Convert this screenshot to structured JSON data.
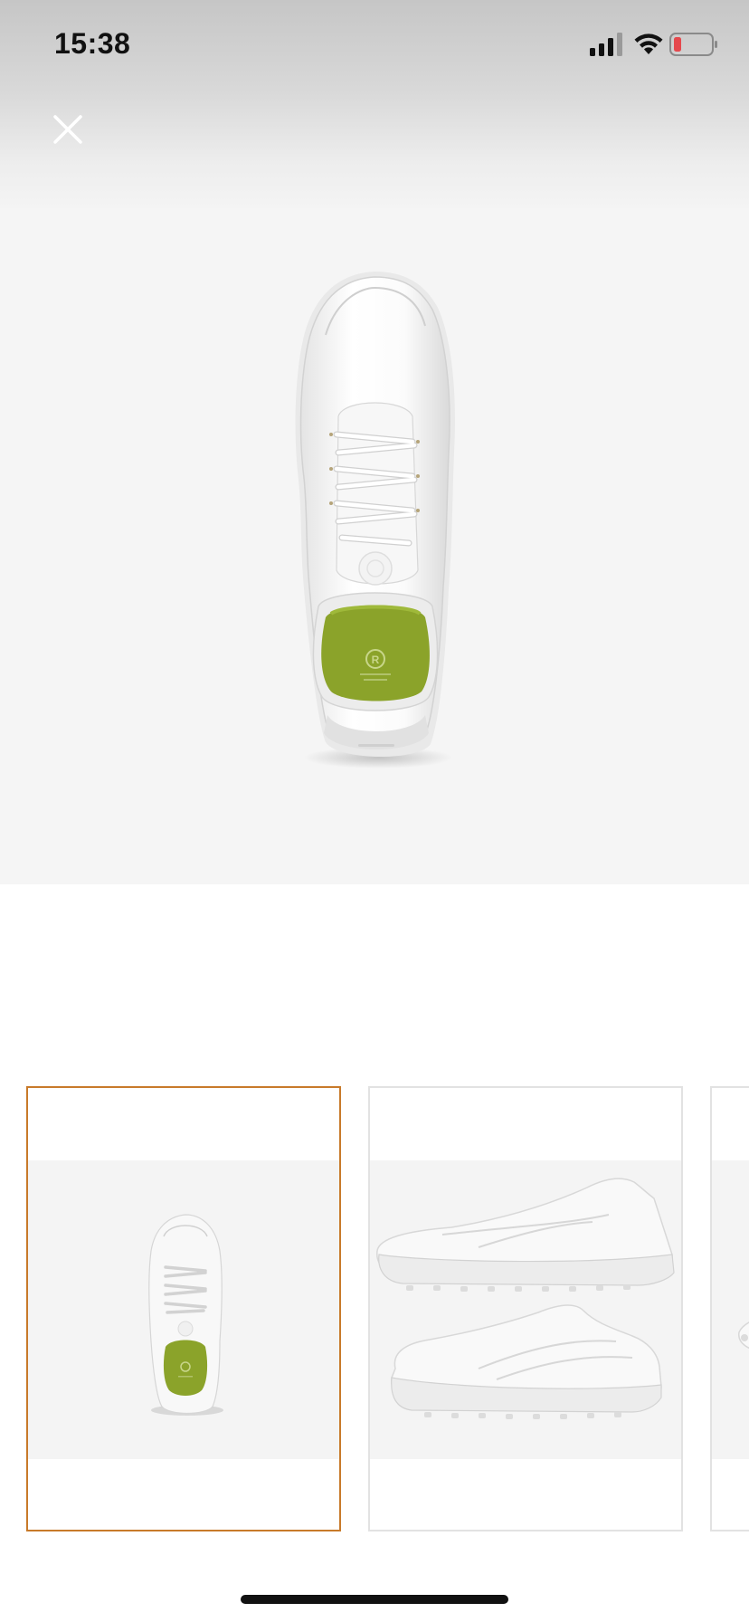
{
  "status_bar": {
    "time": "15:38",
    "icons": [
      "cellular-signal-icon",
      "wifi-icon",
      "battery-low-icon"
    ],
    "battery_color": "#e5484d"
  },
  "header": {
    "close_icon": "close-icon"
  },
  "main_image": {
    "subject": "white-sneaker-top-view",
    "insole_color": "#8ba32a"
  },
  "thumbnails": [
    {
      "subject": "white-sneaker-top-view",
      "selected": true
    },
    {
      "subject": "white-sneaker-pair-side-view",
      "selected": false
    },
    {
      "subject": "white-sneaker-partial",
      "selected": false
    }
  ],
  "colors": {
    "selected_border": "#c87a2a",
    "thumb_border": "#e2e2e2",
    "image_background": "#f5f5f5"
  }
}
